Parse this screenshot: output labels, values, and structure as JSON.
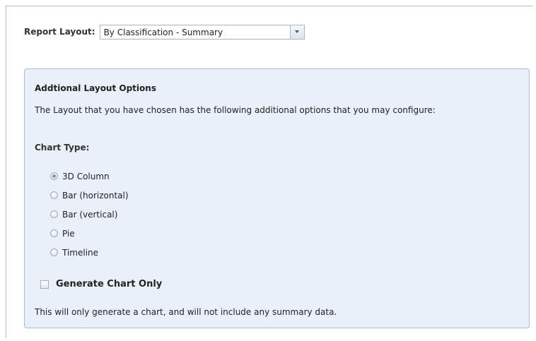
{
  "report_layout": {
    "label": "Report Layout:",
    "selected": "By Classification - Summary",
    "dropdown_icon": "chevron-down-icon"
  },
  "panel": {
    "title": "Addtional Layout Options",
    "description": "The Layout that you have chosen has the following additional options that you may configure:",
    "chart_type_label": "Chart Type:",
    "chart_options": [
      {
        "label": "3D Column",
        "checked": true
      },
      {
        "label": "Bar (horizontal)",
        "checked": false
      },
      {
        "label": "Bar (vertical)",
        "checked": false
      },
      {
        "label": "Pie",
        "checked": false
      },
      {
        "label": "Timeline",
        "checked": false
      }
    ],
    "generate_chart_only": {
      "label": "Generate Chart Only",
      "checked": false
    },
    "note": "This will only generate a chart, and will not include any summary data."
  }
}
